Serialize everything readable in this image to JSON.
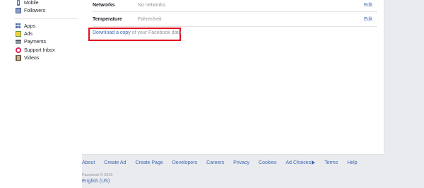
{
  "sidebar": {
    "items": [
      {
        "label": "Mobile",
        "icon": "mobile-icon"
      },
      {
        "label": "Followers",
        "icon": "followers-icon"
      },
      {
        "label": "Apps",
        "icon": "apps-icon"
      },
      {
        "label": "Ads",
        "icon": "ads-icon"
      },
      {
        "label": "Payments",
        "icon": "payments-icon"
      },
      {
        "label": "Support Inbox",
        "icon": "support-inbox-icon"
      },
      {
        "label": "Videos",
        "icon": "videos-icon"
      }
    ]
  },
  "settings": {
    "rows": [
      {
        "label": "Networks",
        "value": "No networks.",
        "edit": "Edit"
      },
      {
        "label": "Temperature",
        "value": "Fahrenheit",
        "edit": "Edit"
      }
    ],
    "download": {
      "link": "Download a copy",
      "rest": " of your Facebook data."
    }
  },
  "footer": {
    "links": [
      "About",
      "Create Ad",
      "Create Page",
      "Developers",
      "Careers",
      "Privacy",
      "Cookies",
      "Ad Choices",
      "Terms",
      "Help"
    ],
    "copyright": "Facebook © 2015",
    "language": "English (US)"
  },
  "colors": {
    "link": "#4267b2",
    "highlight": "#e0121f",
    "background": "#e9ebee"
  }
}
